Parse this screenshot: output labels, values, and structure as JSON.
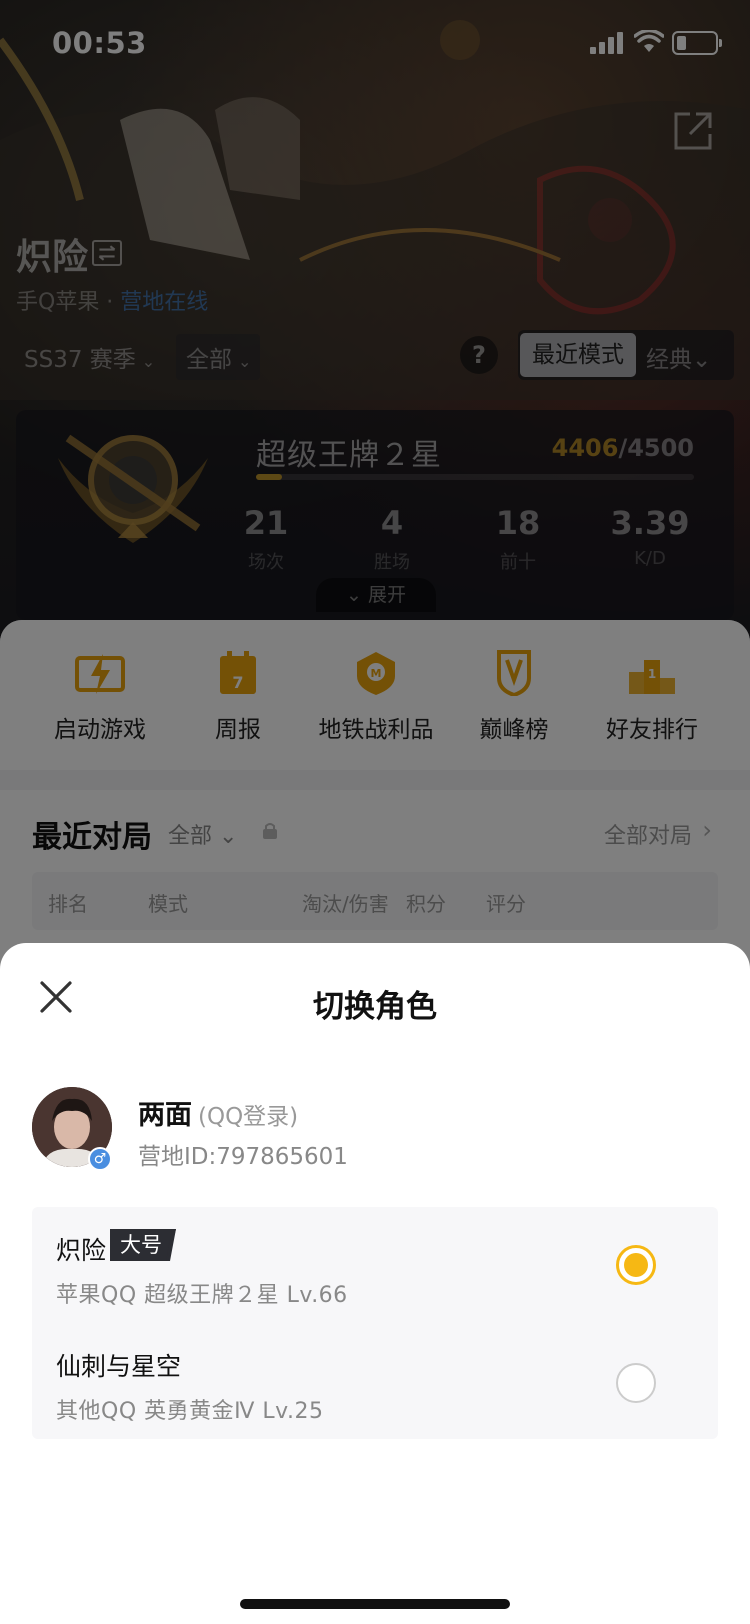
{
  "status_bar": {
    "time": "00:53"
  },
  "header": {
    "player_name": "炽险",
    "platform": "手Q苹果 · ",
    "online_status": "营地在线"
  },
  "filters": {
    "season": "SS37 赛季",
    "scope": "全部",
    "help": "?",
    "mode_recent": "最近模式",
    "mode_classic": "经典"
  },
  "rank_card": {
    "tier": "超级王牌２星",
    "points_current": "4406",
    "points_total": "/4500",
    "progress_fraction": 0.06,
    "stats": [
      {
        "value": "21",
        "label": "场次"
      },
      {
        "value": "4",
        "label": "胜场"
      },
      {
        "value": "18",
        "label": "前十"
      },
      {
        "value": "3.39",
        "label": "K/D"
      }
    ],
    "expand_label": "展开"
  },
  "quick_actions": [
    {
      "label": "启动游戏",
      "icon": "lightning-icon"
    },
    {
      "label": "周报",
      "icon": "calendar-icon"
    },
    {
      "label": "地铁战利品",
      "icon": "metro-shield-icon"
    },
    {
      "label": "巅峰榜",
      "icon": "peak-trophy-icon"
    },
    {
      "label": "好友排行",
      "icon": "podium-icon"
    }
  ],
  "recent_matches": {
    "title": "最近对局",
    "filter": "全部",
    "all_link": "全部对局",
    "columns": [
      "排名",
      "模式",
      "淘汰/伤害",
      "积分",
      "评分"
    ]
  },
  "dialog": {
    "title": "切换角色",
    "account": {
      "name": "两面",
      "login": "(QQ登录)",
      "camp_id": "营地ID:797865601",
      "gender": "♂"
    },
    "roles": [
      {
        "name": "炽险",
        "tag": "大号",
        "meta": "苹果QQ   超级王牌２星   Lv.66",
        "selected": true
      },
      {
        "name": "仙刺与星空",
        "tag": "",
        "meta": "其他QQ   英勇黄金Ⅳ   Lv.25",
        "selected": false
      }
    ]
  },
  "colors": {
    "accent_gold": "#f6b814",
    "link_blue": "#468cdc",
    "tag_dark": "#2c2d33"
  }
}
